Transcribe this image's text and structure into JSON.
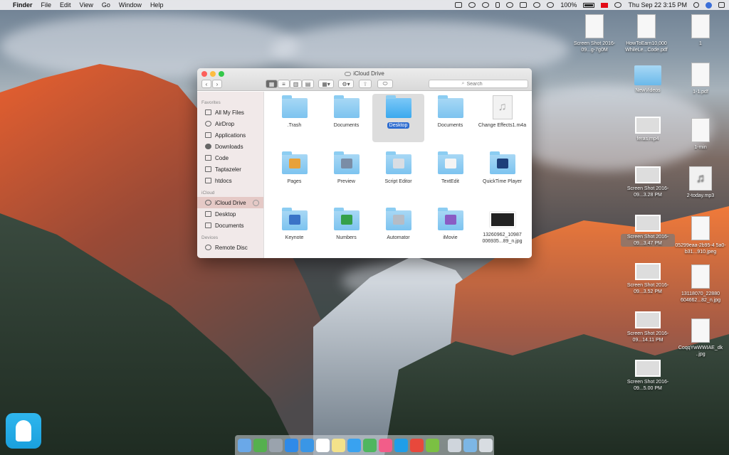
{
  "menubar": {
    "apple_glyph": "",
    "app_name": "Finder",
    "menus": [
      "File",
      "Edit",
      "View",
      "Go",
      "Window",
      "Help"
    ],
    "battery_text": "100%",
    "clock": "Thu Sep 22  3:15 PM"
  },
  "finder": {
    "title": "iCloud Drive",
    "search_placeholder": "Search",
    "sidebar": {
      "favorites_header": "Favorites",
      "favorites": [
        "All My Files",
        "AirDrop",
        "Applications",
        "Downloads",
        "Code",
        "Taptazeler",
        "htdocs"
      ],
      "icloud_header": "iCloud",
      "icloud": [
        "iCloud Drive",
        "Desktop",
        "Documents"
      ],
      "devices_header": "Devices",
      "devices": [
        "Remote Disc"
      ]
    },
    "items": [
      {
        "label": ".Trash",
        "kind": "folder"
      },
      {
        "label": "Documents",
        "kind": "folder"
      },
      {
        "label": "Desktop",
        "kind": "folder",
        "selected": true
      },
      {
        "label": "Documents",
        "kind": "folder"
      },
      {
        "label": "Change Effects1.m4a",
        "kind": "music"
      },
      {
        "label": "Pages",
        "kind": "folder",
        "glyph": "#e8a13a"
      },
      {
        "label": "Preview",
        "kind": "folder",
        "glyph": "#7a8da6"
      },
      {
        "label": "Script Editor",
        "kind": "folder",
        "glyph": "#d9dde3"
      },
      {
        "label": "TextEdit",
        "kind": "folder",
        "glyph": "#f4f4f4"
      },
      {
        "label": "QuickTime Player",
        "kind": "folder",
        "glyph": "#1d3f7a"
      },
      {
        "label": "Keynote",
        "kind": "folder",
        "glyph": "#3a73c7"
      },
      {
        "label": "Numbers",
        "kind": "folder",
        "glyph": "#35a04a"
      },
      {
        "label": "Automator",
        "kind": "folder",
        "glyph": "#b5bcc6"
      },
      {
        "label": "iMovie",
        "kind": "folder",
        "glyph": "#8a5cc4"
      },
      {
        "label": "13260962_10987 006935...89_n.jpg",
        "kind": "image"
      }
    ]
  },
  "desktop": [
    {
      "label": "Screen Shot 2016-09...g-7g0M",
      "kind": "file"
    },
    {
      "label": "HowToEarn10,000 WhileLe...Code.pdf",
      "kind": "file"
    },
    {
      "label": "1",
      "kind": "file"
    },
    {
      "label": "NewVideos",
      "kind": "folder"
    },
    {
      "label": "1-1.pdf",
      "kind": "file"
    },
    {
      "label": "feras.mp4",
      "kind": "shot"
    },
    {
      "label": "1-min",
      "kind": "file"
    },
    {
      "label": "Screen Shot 2016-09...3.28 PM",
      "kind": "shot"
    },
    {
      "label": "2-today.mp3",
      "kind": "music"
    },
    {
      "label": "Screen Shot 2016-09...3.47 PM",
      "kind": "shot"
    },
    {
      "label": "05299eaa-2b95-4 5a0-b31...910.jpeg",
      "kind": "file"
    },
    {
      "label": "Screen Shot 2016-09...3.52 PM",
      "kind": "shot"
    },
    {
      "label": "13118070_22880 604662...82_n.jpg",
      "kind": "file"
    },
    {
      "label": "Screen Shot 2016-09...14.11 PM",
      "kind": "shot"
    },
    {
      "label": "CoqqYwWWIAE_dk ..jpg",
      "kind": "file"
    },
    {
      "label": "Screen Shot 2016-09...5.00 PM",
      "kind": "shot"
    }
  ],
  "dock": {
    "apps": [
      "#6aa8e8",
      "#55b04e",
      "#9aa3ad",
      "#2f8ae8",
      "#3a96e6",
      "#ffffff",
      "#f3e28a",
      "#39a2f0",
      "#4fb65f",
      "#f25d89",
      "#1f9ee8",
      "#e8483c",
      "#7bc043"
    ],
    "trailing": [
      "#cfd5dc",
      "#7cb6e5",
      "#d8dde2"
    ]
  }
}
